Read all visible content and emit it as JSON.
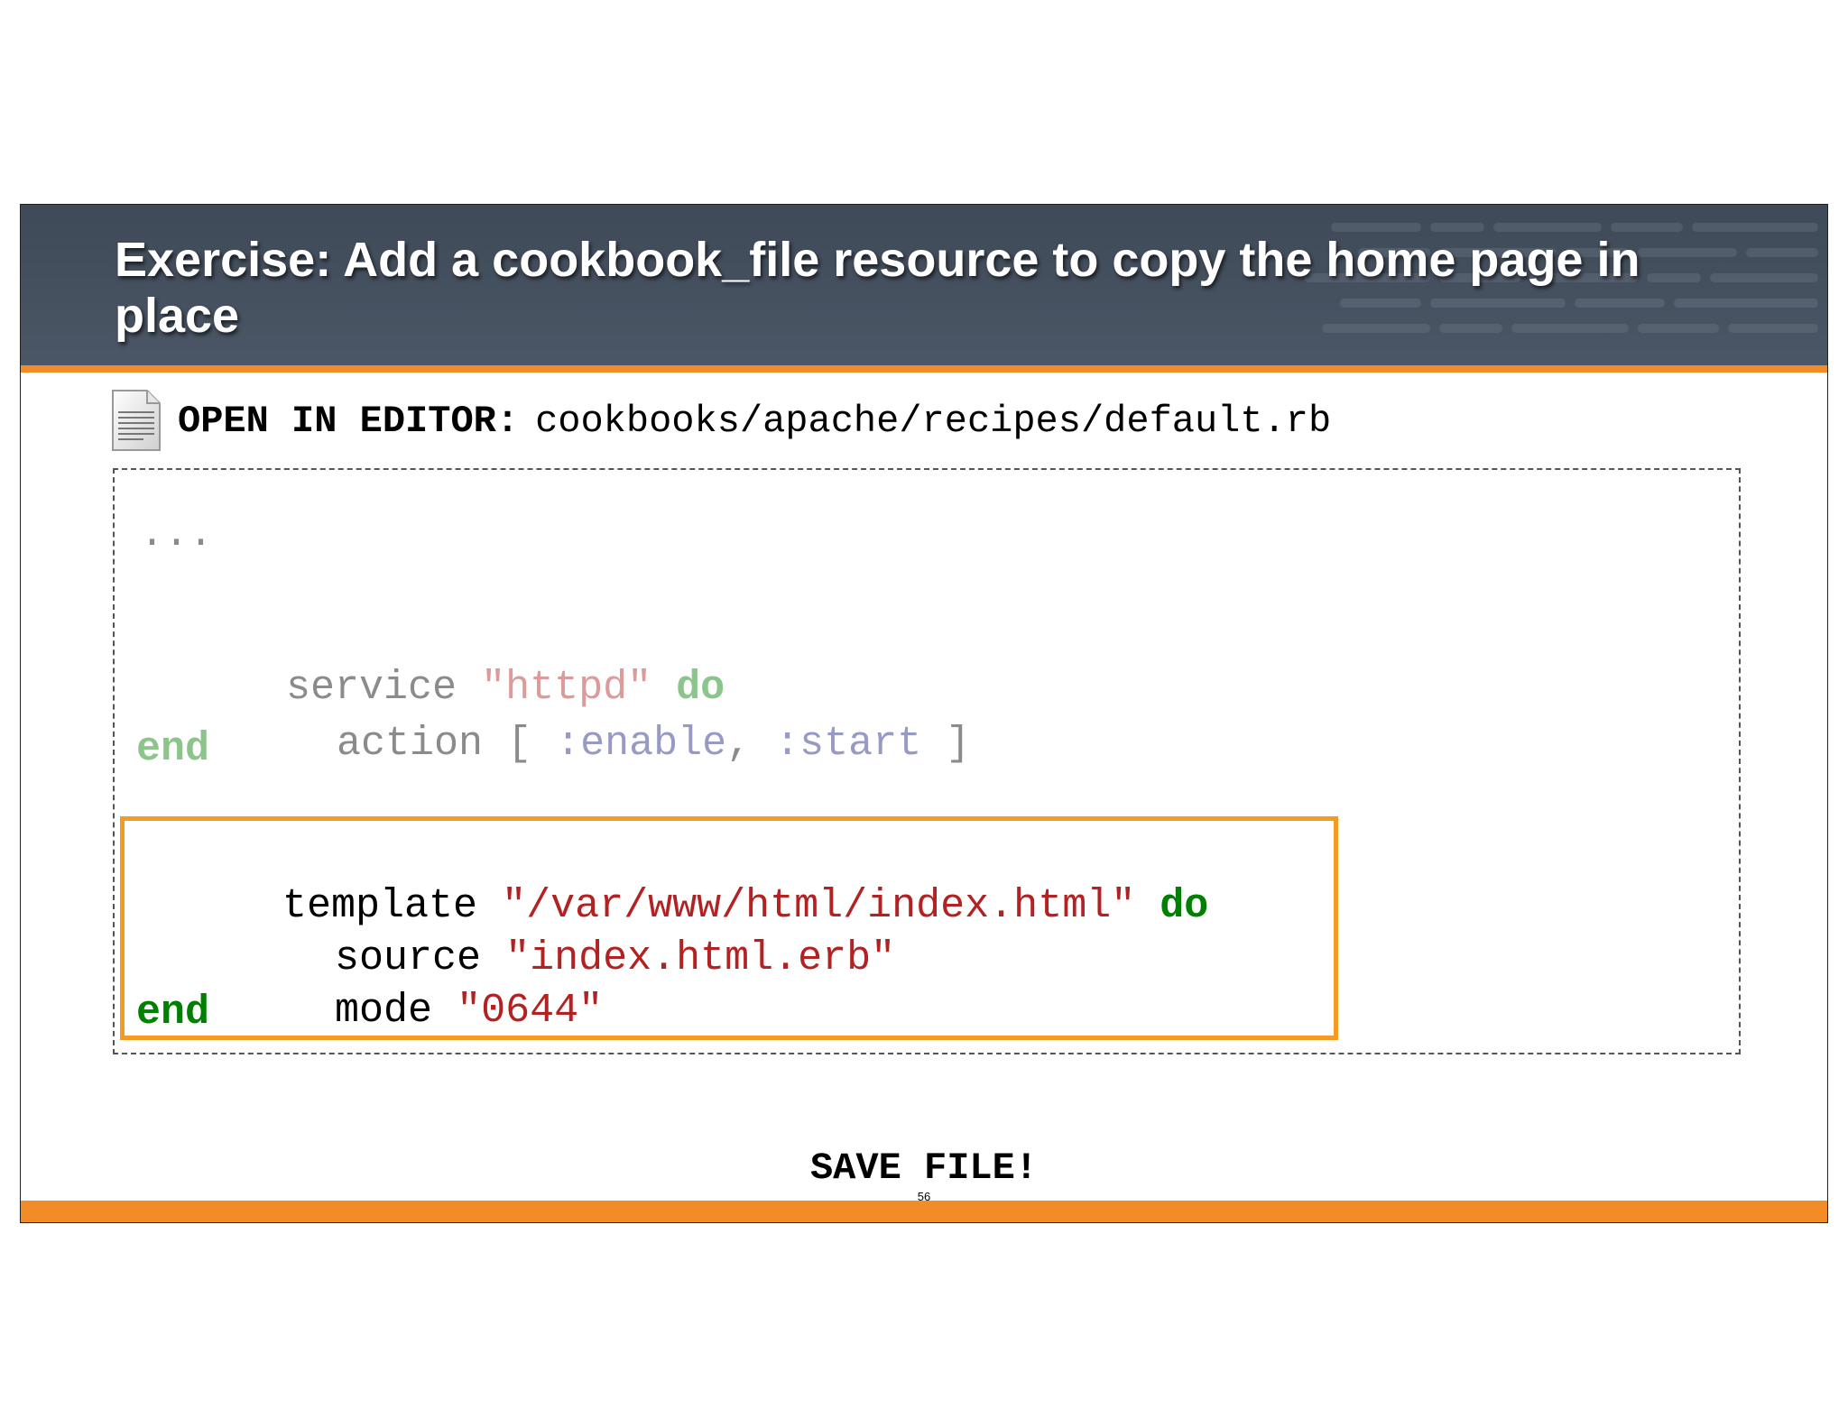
{
  "slide": {
    "title": "Exercise:  Add a cookbook_file resource to copy the home page in place",
    "instruction_label": "OPEN IN EDITOR:",
    "file_path": "cookbooks/apache/recipes/default.rb",
    "icon": "document-icon",
    "save_text": "SAVE FILE!",
    "page_number": "56",
    "colors": {
      "header_bg": "#444f5e",
      "accent": "#f28c28",
      "highlight_border": "#f59a23",
      "string": "#b22222",
      "keyword": "#008000"
    }
  },
  "code": {
    "ellipsis": "...",
    "service": {
      "kw": "service",
      "name": "\"httpd\"",
      "do": "do"
    },
    "action": {
      "kw": "action",
      "open": "[",
      "sym1": ":enable",
      "comma": ",",
      "sym2": ":start",
      "close": "]"
    },
    "service_end": "end",
    "template": {
      "kw": "template",
      "path": "\"/var/www/html/index.html\"",
      "do": "do"
    },
    "source": {
      "kw": "source",
      "value": "\"index.html.erb\""
    },
    "mode": {
      "kw": "mode",
      "value": "\"0644\""
    },
    "template_end": "end"
  }
}
